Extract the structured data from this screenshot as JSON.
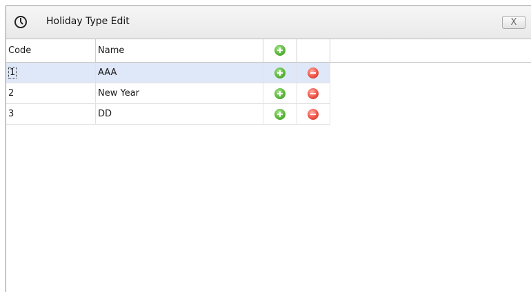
{
  "window": {
    "title": "Holiday Type Edit",
    "close_label": "X",
    "app_icon": "clock-icon"
  },
  "grid": {
    "columns": [
      "Code",
      "Name"
    ],
    "header_add_icon": "add-icon",
    "rows": [
      {
        "code": "1",
        "name": "AAA",
        "selected": true
      },
      {
        "code": "2",
        "name": "New Year",
        "selected": false
      },
      {
        "code": "3",
        "name": "DD",
        "selected": false
      }
    ],
    "row_add_icon": "add-icon",
    "row_delete_icon": "delete-icon"
  },
  "colors": {
    "selected_row": "#dfe8f8",
    "add": "#5cb83c",
    "delete": "#ef5246"
  }
}
